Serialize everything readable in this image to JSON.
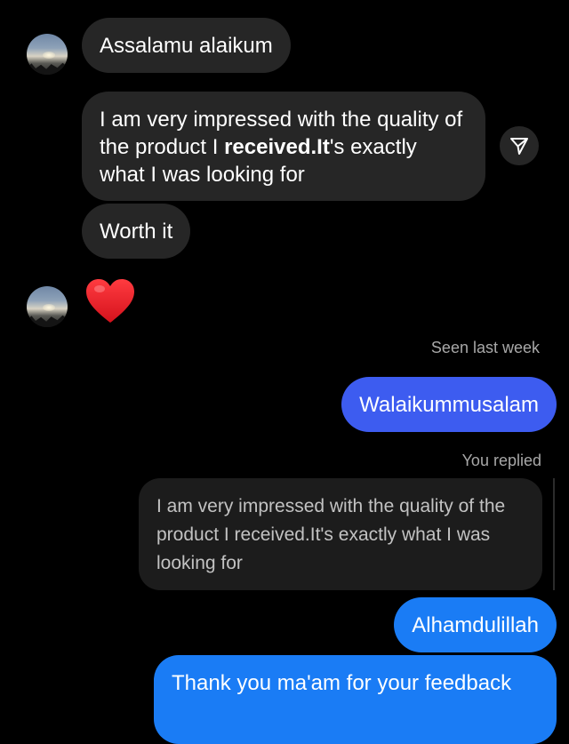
{
  "messages": {
    "greeting": "Assalamu alaikum",
    "feedback": {
      "before": "I am very impressed with the quality of the product I ",
      "bold": "received.It",
      "after": "'s exactly what I was looking for"
    },
    "worth": "Worth it",
    "heart": "❤️"
  },
  "seen_label": "Seen last week",
  "my_reply": "Walaikummusalam",
  "replied_label": "You replied",
  "quoted": "I am very impressed with the quality of the product I received.It's exactly what I was looking for",
  "alhamdulillah": "Alhamdulillah",
  "thank_you": "Thank you ma'am for your feedback",
  "icons": {
    "share": "paper-plane-icon",
    "avatar": "sunset-landscape-avatar"
  },
  "colors": {
    "incoming": "#262626",
    "outgoing": "#3d5cf0",
    "outgoing_alt": "#1a7cf5"
  }
}
